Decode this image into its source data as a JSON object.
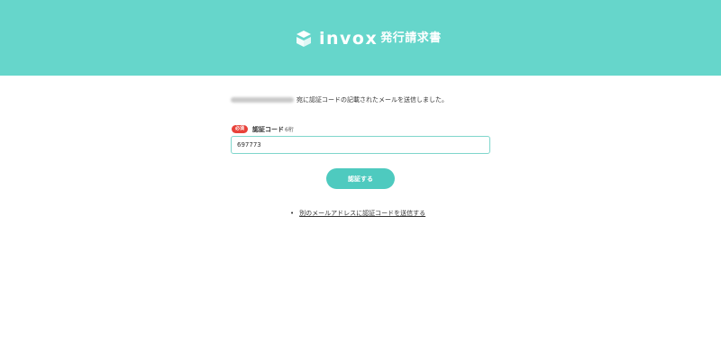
{
  "colors": {
    "header_bg": "#66d6cb",
    "button_bg": "#4ecabf",
    "required_badge": "#e8423a",
    "input_border": "#7fd6cc"
  },
  "header": {
    "logo_icon": "cube-logo-icon",
    "brand": "invox",
    "product": "発行請求書"
  },
  "message": {
    "sent_text": "宛に認証コードの記載されたメールを送信しました。"
  },
  "form": {
    "required_badge": "必須",
    "label": "認証コード",
    "label_hint": "6桁",
    "code_value": "697773",
    "submit_label": "認証する"
  },
  "links": {
    "resend_other_email": "別のメールアドレスに認証コードを送信する"
  }
}
